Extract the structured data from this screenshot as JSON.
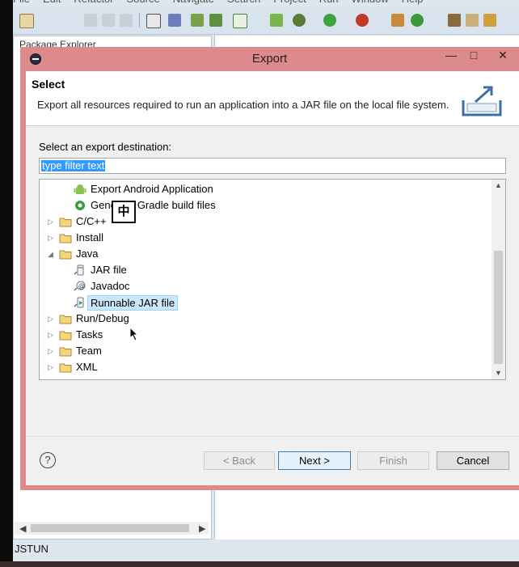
{
  "ide": {
    "menus": [
      "File",
      "Edit",
      "Refactor",
      "Source",
      "Navigate",
      "Search",
      "Project",
      "Run",
      "Window",
      "Help"
    ],
    "explorer_tab": "Package Explorer",
    "status_text": "JSTUN"
  },
  "dialog": {
    "title": "Export",
    "minimize": "—",
    "maximize": "□",
    "close": "✕",
    "header_title": "Select",
    "header_description": "Export all resources required to run an application into a JAR file on the local file system.",
    "destination_label": "Select an export destination:",
    "filter_placeholder": "type filter text",
    "tree": [
      {
        "label": "Export Android Application",
        "icon": "android-icon",
        "expandable": false,
        "indent": 1
      },
      {
        "label": "Generate Gradle build files",
        "icon": "gradle-icon",
        "expandable": false,
        "indent": 1
      },
      {
        "label": "C/C++",
        "icon": "folder-icon",
        "expandable": true,
        "expanded": false,
        "indent": 0
      },
      {
        "label": "Install",
        "icon": "folder-icon",
        "expandable": true,
        "expanded": false,
        "indent": 0
      },
      {
        "label": "Java",
        "icon": "folder-icon",
        "expandable": true,
        "expanded": true,
        "indent": 0
      },
      {
        "label": "JAR file",
        "icon": "jar-icon",
        "expandable": false,
        "indent": 1
      },
      {
        "label": "Javadoc",
        "icon": "javadoc-icon",
        "expandable": false,
        "indent": 1
      },
      {
        "label": "Runnable JAR file",
        "icon": "runnable-jar-icon",
        "expandable": false,
        "indent": 1,
        "selected": true
      },
      {
        "label": "Run/Debug",
        "icon": "folder-icon",
        "expandable": true,
        "expanded": false,
        "indent": 0
      },
      {
        "label": "Tasks",
        "icon": "folder-icon",
        "expandable": true,
        "expanded": false,
        "indent": 0
      },
      {
        "label": "Team",
        "icon": "folder-icon",
        "expandable": true,
        "expanded": false,
        "indent": 0
      },
      {
        "label": "XML",
        "icon": "folder-icon",
        "expandable": true,
        "expanded": false,
        "indent": 0
      }
    ],
    "ime_indicator": "中",
    "buttons": {
      "help": "?",
      "back": "< Back",
      "next": "Next >",
      "finish": "Finish",
      "cancel": "Cancel"
    },
    "colors": {
      "title_bar": "#dc8a8c",
      "selection_bg": "#cce8ff",
      "filter_selection": "#3399ff"
    }
  }
}
